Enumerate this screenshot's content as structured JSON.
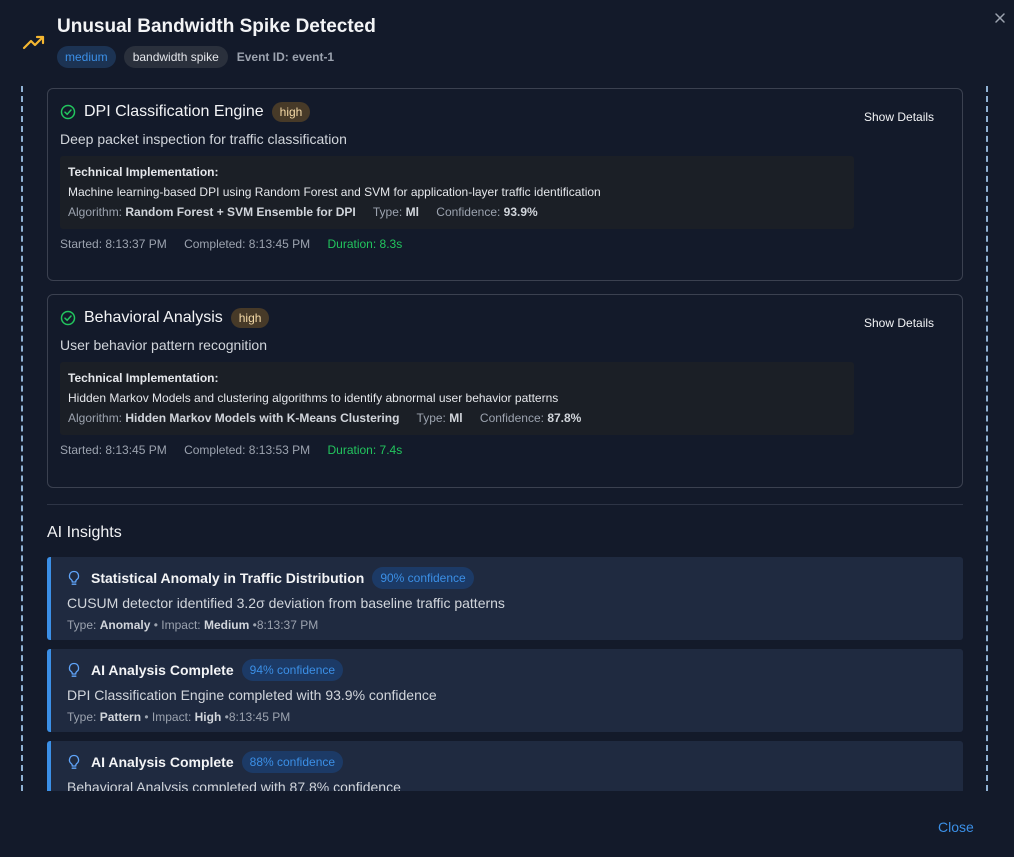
{
  "header": {
    "title": "Unusual Bandwidth Spike Detected",
    "severity": "medium",
    "event_type": "bandwidth spike",
    "event_id": "Event ID: event-1",
    "icon": "trending-up-icon",
    "accent_color": "#f5b731"
  },
  "engines": [
    {
      "title": "DPI Classification Engine",
      "priority": "high",
      "description": "Deep packet inspection for traffic classification",
      "show_details": "Show Details",
      "tech_title": "Technical Implementation:",
      "tech_description": "Machine learning-based DPI using Random Forest and SVM for application-layer traffic identification",
      "algorithm_label": "Algorithm:",
      "algorithm": "Random Forest + SVM Ensemble for DPI",
      "type_label": "Type:",
      "type": "Ml",
      "confidence_label": "Confidence:",
      "confidence": "93.9%",
      "started": "Started: 8:13:37 PM",
      "completed": "Completed: 8:13:45 PM",
      "duration": "Duration: 8.3s"
    },
    {
      "title": "Behavioral Analysis",
      "priority": "high",
      "description": "User behavior pattern recognition",
      "show_details": "Show Details",
      "tech_title": "Technical Implementation:",
      "tech_description": "Hidden Markov Models and clustering algorithms to identify abnormal user behavior patterns",
      "algorithm_label": "Algorithm:",
      "algorithm": "Hidden Markov Models with K-Means Clustering",
      "type_label": "Type:",
      "type": "Ml",
      "confidence_label": "Confidence:",
      "confidence": "87.8%",
      "started": "Started: 8:13:45 PM",
      "completed": "Completed: 8:13:53 PM",
      "duration": "Duration: 7.4s"
    }
  ],
  "insights_section": {
    "title": "AI Insights",
    "items": [
      {
        "title": "Statistical Anomaly in Traffic Distribution",
        "confidence": "90% confidence",
        "description": "CUSUM detector identified 3.2σ deviation from baseline traffic patterns",
        "type_label": "Type:",
        "type": "Anomaly",
        "impact_label": "• Impact:",
        "impact": "Medium",
        "time": "•8:13:37 PM"
      },
      {
        "title": "AI Analysis Complete",
        "confidence": "94% confidence",
        "description": "DPI Classification Engine completed with 93.9% confidence",
        "type_label": "Type:",
        "type": "Pattern",
        "impact_label": "• Impact:",
        "impact": "High",
        "time": "•8:13:45 PM"
      },
      {
        "title": "AI Analysis Complete",
        "confidence": "88% confidence",
        "description": "Behavioral Analysis completed with 87.8% confidence"
      }
    ]
  },
  "footer": {
    "close_label": "Close"
  },
  "colors": {
    "background": "#131a2a",
    "accent_blue": "#3b8fe6",
    "success_green": "#22c55e",
    "priority_bg": "#473a28"
  }
}
